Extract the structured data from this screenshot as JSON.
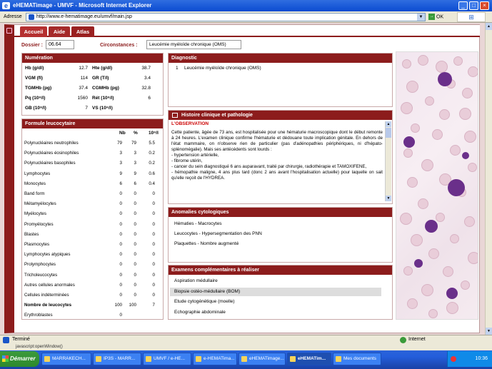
{
  "window": {
    "title": "eHEMATimage - UMVF - Microsoft Internet Explorer",
    "minimize": "_",
    "maximize": "□",
    "close": "×"
  },
  "address": {
    "label": "Adresse",
    "url": "http://www.e-hematimage.eu/umvf/main.jsp",
    "go": "OK",
    "drop": "▼"
  },
  "tabs": [
    {
      "label": "Accueil"
    },
    {
      "label": "Aide"
    },
    {
      "label": "Atlas"
    }
  ],
  "dossier": {
    "label": "Dossier :",
    "value": "06.64"
  },
  "circonstances": {
    "label": "Circonstances :",
    "value": "Leucémie myéloïde chronique (OMS)"
  },
  "numeration": {
    "title": "Numération",
    "rows": [
      {
        "l1": "Hb (g/dl)",
        "v1": "12.7",
        "l2": "Hte (g/dl)",
        "v2": "38.7"
      },
      {
        "l1": "VGM (fl)",
        "v1": "114",
        "l2": "GR (T/l)",
        "v2": "3.4"
      },
      {
        "l1": "TGMHb (pg)",
        "v1": "37.4",
        "l2": "CGMHb (pg)",
        "v2": "32.8"
      },
      {
        "l1": "Pq (10⁹/l)",
        "v1": "1560",
        "l2": "Rét (10⁹/l)",
        "v2": "6"
      },
      {
        "l1": "GB (10⁹/l)",
        "v1": "7",
        "l2": "VS (10⁹/l)",
        "v2": ""
      }
    ]
  },
  "formule": {
    "title": "Formule leucocytaire",
    "headers": [
      "Nb",
      "%",
      "10⁹/l"
    ],
    "rows": [
      {
        "label": "Polynucléaires neutrophiles",
        "nb": "79",
        "pct": "79",
        "abs": "5.5"
      },
      {
        "label": "Polynucléaires éosinophiles",
        "nb": "3",
        "pct": "3",
        "abs": "0.2"
      },
      {
        "label": "Polynucléaires basophiles",
        "nb": "3",
        "pct": "3",
        "abs": "0.2"
      },
      {
        "label": "Lymphocytes",
        "nb": "9",
        "pct": "9",
        "abs": "0.6"
      },
      {
        "label": "Monocytes",
        "nb": "6",
        "pct": "6",
        "abs": "0.4"
      },
      {
        "label": "Band form",
        "nb": "0",
        "pct": "0",
        "abs": "0"
      },
      {
        "label": "Métamyélocytes",
        "nb": "0",
        "pct": "0",
        "abs": "0"
      },
      {
        "label": "Myélocytes",
        "nb": "0",
        "pct": "0",
        "abs": "0"
      },
      {
        "label": "Promyélocytes",
        "nb": "0",
        "pct": "0",
        "abs": "0"
      },
      {
        "label": "Blastes",
        "nb": "0",
        "pct": "0",
        "abs": "0"
      },
      {
        "label": "Plasmocytes",
        "nb": "0",
        "pct": "0",
        "abs": "0"
      },
      {
        "label": "Lymphocytes atypiques",
        "nb": "0",
        "pct": "0",
        "abs": "0"
      },
      {
        "label": "Prolymphocytes",
        "nb": "0",
        "pct": "0",
        "abs": "0"
      },
      {
        "label": "Tricholeucocytes",
        "nb": "0",
        "pct": "0",
        "abs": "0"
      },
      {
        "label": "Autres cellules anormales",
        "nb": "0",
        "pct": "0",
        "abs": "0"
      },
      {
        "label": "Cellules indéterminées",
        "nb": "0",
        "pct": "0",
        "abs": "0"
      },
      {
        "label": "Nombre de leucocytes",
        "nb": "100",
        "pct": "100",
        "abs": "7"
      },
      {
        "label": "Erythroblastes",
        "nb": "0",
        "pct": "",
        "abs": ""
      }
    ]
  },
  "diagnostic": {
    "title": "Diagnostic",
    "num": "1",
    "value": "Leucémie myéloïde chronique (OMS)"
  },
  "histoire": {
    "title": "Histoire clinique et pathologie",
    "section": "L'OBSERVATION",
    "text": "Cette patiente, âgée de 73 ans, est hospitalisée pour une hématurie macroscopique dont le début remonte à 24 heures. L'examen clinique confirme l'hématurie et dédouane toute implication génitale. En dehors de l'état mammaire, on n'observe rien de particulier (pas d'adénopathies périphériques, ni d'hépato-splénomégalie). Mais ses antécédents sont lourds :",
    "items": [
      "- hypertension artérielle,",
      "- fibrome utérin,",
      "- cancer du sein diagnostiqué 6 ans auparavant, traité par chirurgie, radiothérapie et TAMOXIFENE,",
      "- hémopathie maligne, 4 ans plus tard (donc 2 ans avant l'hospitalisation actuelle) pour laquelle on sait qu'elle reçoit de l'HYDREA."
    ]
  },
  "anomalies": {
    "title": "Anomalies cytologiques",
    "items": [
      "Hématies - Macrocytes",
      "Leucocytes - Hypersegmentation des PNN",
      "Plaquettes - Nombre augmenté"
    ]
  },
  "examens": {
    "title": "Examens complémentaires à réaliser",
    "items": [
      "Aspiration médullaire",
      "Biopsie ostéo-médullaire (BOM)",
      "Etude cytogénétique (moelle)",
      "Echographie abdominale"
    ]
  },
  "status": {
    "text": "Terminé",
    "zone": "Internet"
  },
  "taskbar": {
    "js": "javascript:openWindow()",
    "start": "Démarrer",
    "tasks": [
      "MARRAKECH...",
      "IP3S - MARR...",
      "UMVF / e-HE...",
      "e-HEMATima...",
      "eHEMATimage...",
      "eHEMATim...",
      "Mes documents"
    ],
    "clock": "10:36"
  }
}
